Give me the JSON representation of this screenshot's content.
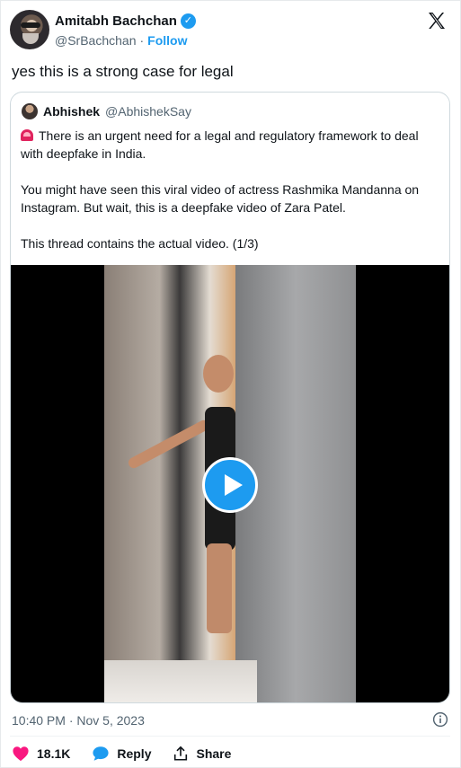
{
  "author": {
    "name": "Amitabh Bachchan",
    "handle": "@SrBachchan",
    "separator": "·",
    "follow_label": "Follow"
  },
  "tweet": {
    "text": "yes this is a strong case for legal",
    "timestamp": "10:40 PM · Nov 5, 2023"
  },
  "quoted": {
    "name": "Abhishek",
    "handle": "@AbhishekSay",
    "paragraphs": [
      "There is an urgent need for a legal and regulatory framework to deal with deepfake in India.",
      "You might have seen this viral video of actress Rashmika Mandanna on Instagram. But wait, this is a deepfake video of Zara Patel.",
      "This thread contains the actual video.  (1/3)"
    ]
  },
  "actions": {
    "like_count": "18.1K",
    "reply_label": "Reply",
    "share_label": "Share"
  },
  "colors": {
    "accent": "#1d9bf0",
    "like": "#f91880",
    "text_secondary": "#536471"
  },
  "icons": {
    "verified": "verified-badge-icon",
    "x_logo": "x-logo-icon",
    "siren": "siren-emoji-icon",
    "play": "play-icon",
    "info": "info-icon",
    "heart": "heart-icon",
    "reply": "reply-bubble-icon",
    "share": "share-icon"
  }
}
